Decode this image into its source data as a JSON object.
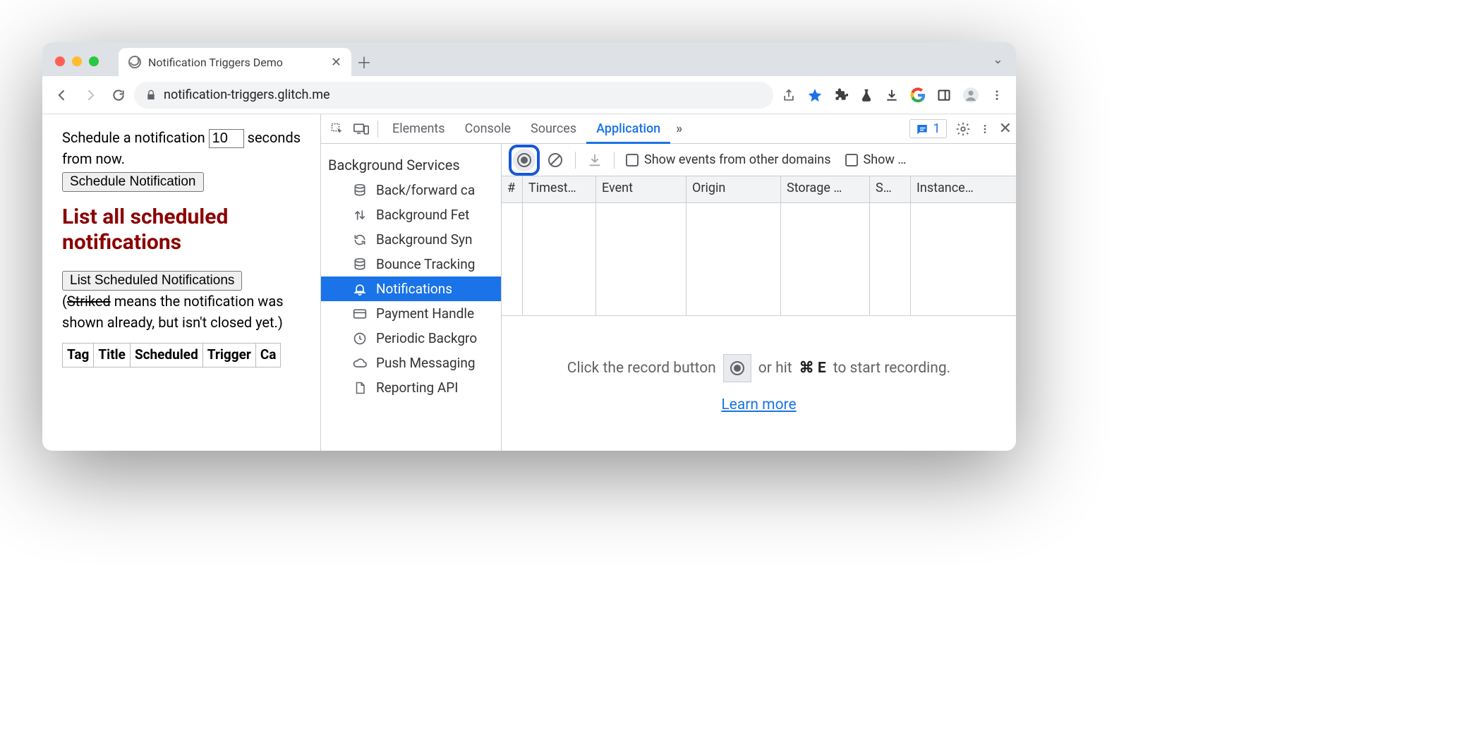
{
  "browser": {
    "tab_title": "Notification Triggers Demo",
    "url": "notification-triggers.glitch.me"
  },
  "page": {
    "schedule_text_a": "Schedule a notification ",
    "schedule_value": "10",
    "schedule_text_b": " seconds from now.",
    "schedule_button": "Schedule Notification",
    "heading": "List all scheduled notifications",
    "list_button": "List Scheduled Notifications",
    "note_a": "(",
    "note_strike": "Striked",
    "note_b": " means the notification was shown already, but isn't closed yet.)",
    "table_headers": [
      "Tag",
      "Title",
      "Scheduled",
      "Trigger",
      "Ca"
    ]
  },
  "devtools": {
    "tabs": [
      "Elements",
      "Console",
      "Sources",
      "Application"
    ],
    "more": "»",
    "issues_count": "1",
    "sidebar": {
      "section": "Background Services",
      "items": [
        {
          "label": "Back/forward ca",
          "icon": "db"
        },
        {
          "label": "Background Fet",
          "icon": "updown"
        },
        {
          "label": "Background Syn",
          "icon": "sync"
        },
        {
          "label": "Bounce Tracking",
          "icon": "db"
        },
        {
          "label": "Notifications",
          "icon": "bell",
          "selected": true
        },
        {
          "label": "Payment Handle",
          "icon": "card"
        },
        {
          "label": "Periodic Backgro",
          "icon": "clock"
        },
        {
          "label": "Push Messaging",
          "icon": "cloud"
        },
        {
          "label": "Reporting API",
          "icon": "doc"
        }
      ]
    },
    "toolbar2": {
      "cb1_label": "Show events from other domains",
      "cb2_label": "Show …"
    },
    "grid_headers": [
      "#",
      "Timest…",
      "Event",
      "Origin",
      "Storage …",
      "S…",
      "Instance…"
    ],
    "prompt_a": "Click the record button ",
    "prompt_b": " or hit ",
    "prompt_key": "⌘ E",
    "prompt_c": " to start recording.",
    "learn": "Learn more"
  }
}
